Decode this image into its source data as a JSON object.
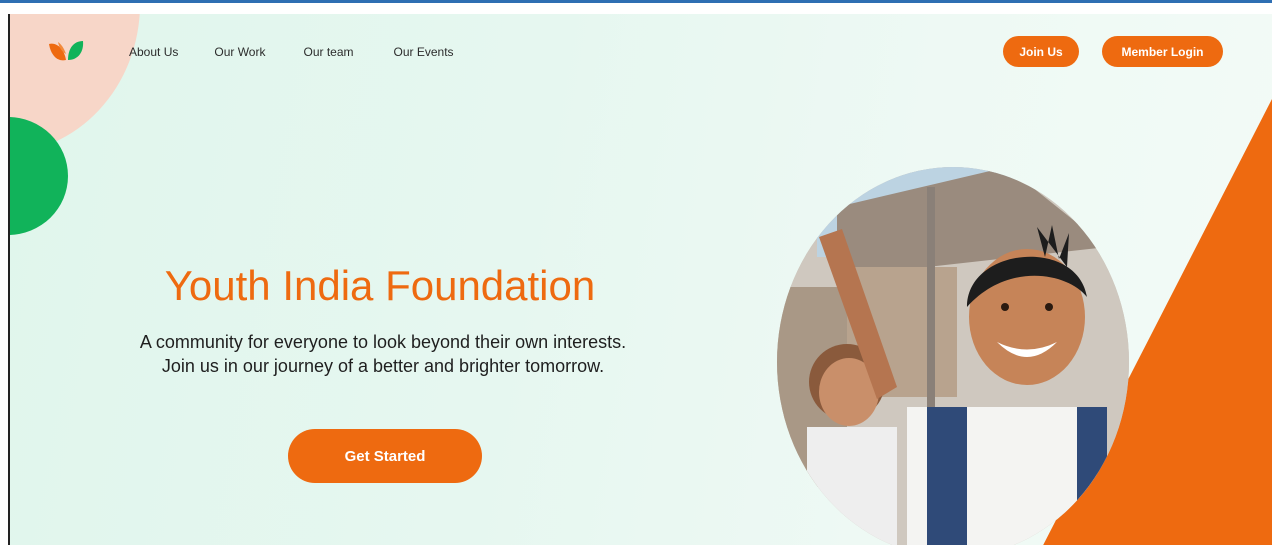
{
  "nav": {
    "items": [
      {
        "label": "About Us"
      },
      {
        "label": "Our Work"
      },
      {
        "label": "Our team"
      },
      {
        "label": "Our Events"
      }
    ]
  },
  "header": {
    "join_label": "Join Us",
    "login_label": "Member Login"
  },
  "hero": {
    "title": "Youth India Foundation",
    "subtitle": "A community for everyone to look beyond their own interests. Join us in our journey of a better and brighter tomorrow.",
    "cta_label": "Get Started"
  },
  "colors": {
    "accent": "#ee6a10",
    "green": "#11b35a",
    "peach": "#f7d6c8",
    "background": "#e6f7f0"
  },
  "icons": {
    "logo": "leaf-logo-icon"
  }
}
